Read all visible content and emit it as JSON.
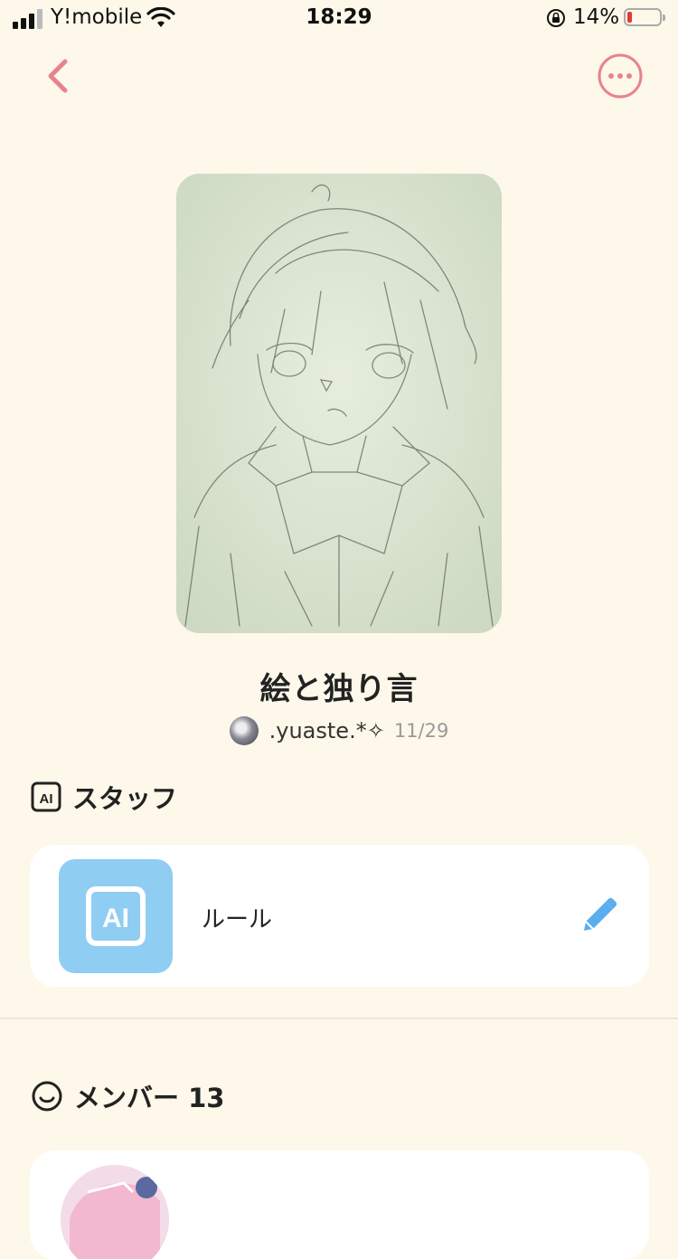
{
  "status_bar": {
    "carrier": "Y!mobile",
    "time": "18:29",
    "battery_percent": "14%",
    "battery_level": 0.14
  },
  "nav": {
    "back_icon": "chevron-left-icon",
    "more_icon": "ellipsis-circle-icon"
  },
  "book": {
    "title": "絵と独り言",
    "author": ".yuaste.*✧",
    "date": "11/29"
  },
  "staff_section": {
    "heading": "スタッフ",
    "icon_text": "AI",
    "items": [
      {
        "icon_text": "AI",
        "label": "ルール"
      }
    ]
  },
  "member_section": {
    "heading": "メンバー 13"
  },
  "colors": {
    "background": "#fdf8e9",
    "accent_pink": "#e8838e",
    "ai_blue": "#8fcdf3",
    "edit_blue": "#5aaef0"
  }
}
